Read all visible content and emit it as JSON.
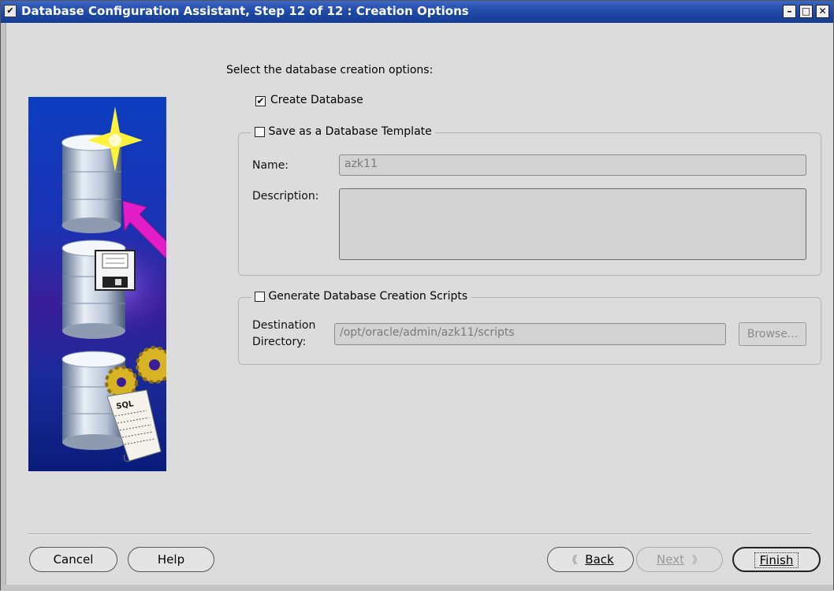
{
  "window": {
    "title": "Database Configuration Assistant, Step 12 of 12 : Creation Options",
    "menu_glyph": "✔",
    "minimize_glyph": "–",
    "maximize_glyph": "□",
    "close_glyph": "✕"
  },
  "main": {
    "prompt": "Select the database creation options:",
    "create_database": {
      "label": "Create Database",
      "checked": true,
      "mark": "✔"
    },
    "save_template": {
      "label": "Save as a Database Template",
      "checked": false,
      "name_label": "Name:",
      "name_value": "azk11",
      "description_label": "Description:",
      "description_value": ""
    },
    "generate_scripts": {
      "label": "Generate Database Creation Scripts",
      "checked": false,
      "destination_label_line1": "Destination",
      "destination_label_line2": "Directory:",
      "destination_value": "/opt/oracle/admin/azk11/scripts",
      "browse_label": "Browse..."
    }
  },
  "art": {
    "sql_label": "SQL"
  },
  "footer": {
    "cancel": "Cancel",
    "help": "Help",
    "back": "Back",
    "back_glyph": "《",
    "next": "Next",
    "next_glyph": "》",
    "finish": "Finish"
  },
  "colors": {
    "titlebar": "#2049a8",
    "art_background": "#1a32b3",
    "arrow": "#e31ec8",
    "star": "#fff23a"
  }
}
